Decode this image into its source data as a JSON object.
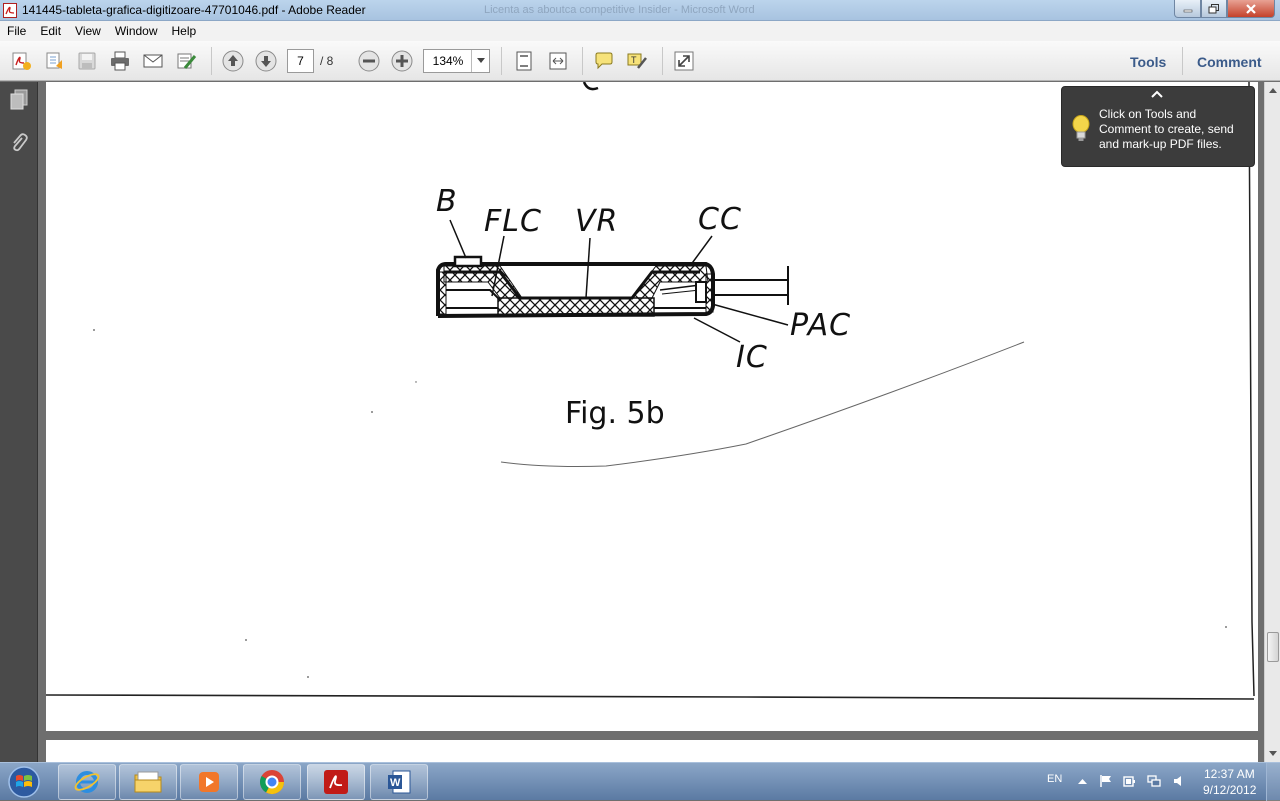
{
  "window": {
    "title": "141445-tableta-grafica-digitizoare-47701046.pdf - Adobe Reader",
    "background_title": "Licenta as aboutca competitive Insider - Microsoft Word"
  },
  "menu": [
    "File",
    "Edit",
    "View",
    "Window",
    "Help"
  ],
  "toolbar": {
    "page_current": "7",
    "page_total": "/  8",
    "zoom": "134%",
    "tools_label": "Tools",
    "comment_label": "Comment"
  },
  "tooltip": {
    "text": "Click on Tools and Comment to create, send and mark-up PDF files."
  },
  "figure": {
    "labels": {
      "b": "B",
      "flc": "FLC",
      "vr": "VR",
      "cc": "CC",
      "pac": "PAC",
      "ic": "IC"
    },
    "caption": "Fig. 5b"
  },
  "taskbar": {
    "language": "EN",
    "time": "12:37 AM",
    "date": "9/12/2012"
  },
  "colors": {
    "link": "#3b5b8a",
    "tooltip_bg": "#3c3c3c",
    "taskbar": "#5b7aa3"
  }
}
